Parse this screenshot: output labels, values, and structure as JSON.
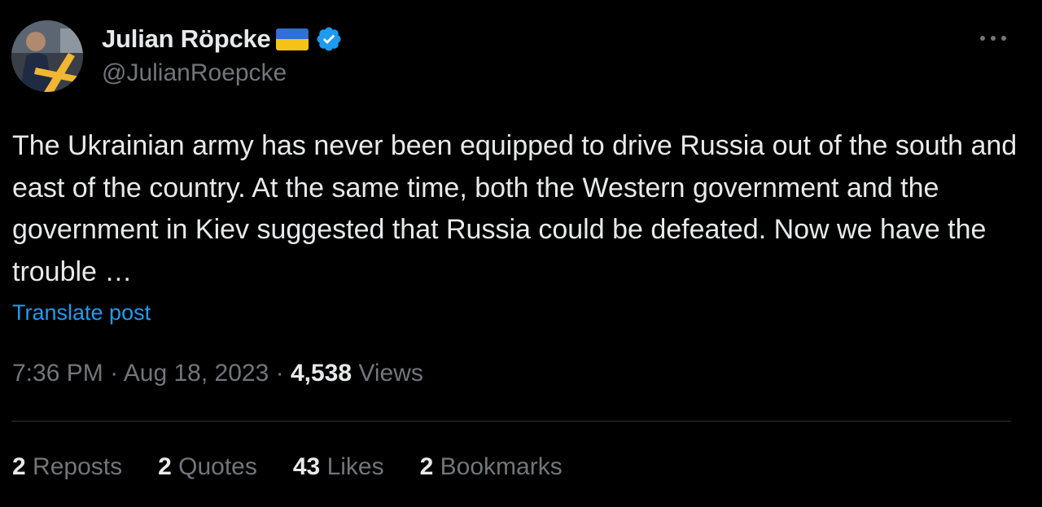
{
  "author": {
    "display_name": "Julian Röpcke",
    "handle": "@JulianRoepcke",
    "flag": "ukraine-flag",
    "verified_icon": "verified-badge-icon",
    "verified_color": "#1d9bf0"
  },
  "tweet": {
    "text": "The Ukrainian army has never been equipped to drive Russia out of the south and east of the country. At the same time, both the Western government and the government in Kiev suggested that Russia could be defeated. Now we have the trouble …",
    "translate_label": "Translate post"
  },
  "meta": {
    "time": "7:36 PM",
    "separator": "·",
    "date": "Aug 18, 2023",
    "views_count": "4,538",
    "views_label": "Views"
  },
  "stats": [
    {
      "count": "2",
      "label": "Reposts"
    },
    {
      "count": "2",
      "label": "Quotes"
    },
    {
      "count": "43",
      "label": "Likes"
    },
    {
      "count": "2",
      "label": "Bookmarks"
    }
  ],
  "colors": {
    "background": "#000000",
    "text_primary": "#e7e9ea",
    "text_secondary": "#71767b",
    "link": "#1d9bf0",
    "divider": "#2f3336"
  }
}
